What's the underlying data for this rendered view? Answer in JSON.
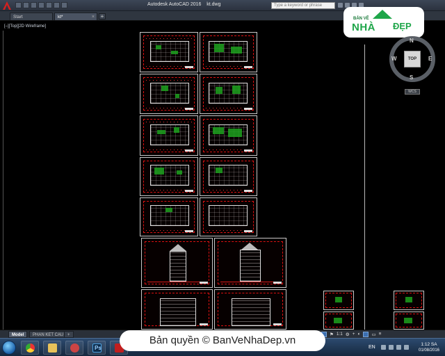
{
  "titlebar": {
    "app_name": "Autodesk AutoCAD 2016",
    "file_name": "kt.dwg",
    "search_placeholder": "Type a keyword or phrase"
  },
  "file_tabs": [
    {
      "label": "Start"
    },
    {
      "label": "kt*"
    }
  ],
  "viewport": {
    "label": "[–][Top][2D Wireframe]"
  },
  "viewcube": {
    "north": "N",
    "south": "S",
    "east": "E",
    "west": "W",
    "face": "TOP",
    "wcs": "WCS"
  },
  "watermark": {
    "small_text": "BẢN VẼ",
    "brand_main": "NHÀ",
    "brand_tail": "ĐẸP"
  },
  "layout_tabs": [
    {
      "label": "Model"
    },
    {
      "label": "PHAN KET CAU"
    }
  ],
  "status_bar": {
    "scale": "1:1"
  },
  "taskbar": {
    "language": "EN",
    "time": "1:12 SA",
    "date": "01/08/2016"
  },
  "copyright": {
    "text": "Bản quyền © BanVeNhaDep.vn"
  },
  "icons": {
    "app_logo": "autocad-a-icon",
    "start": "windows-start-icon",
    "chrome": "chrome-icon",
    "explorer": "folder-icon",
    "photoshop": "photoshop-icon",
    "autocad": "autocad-taskbar-icon"
  }
}
